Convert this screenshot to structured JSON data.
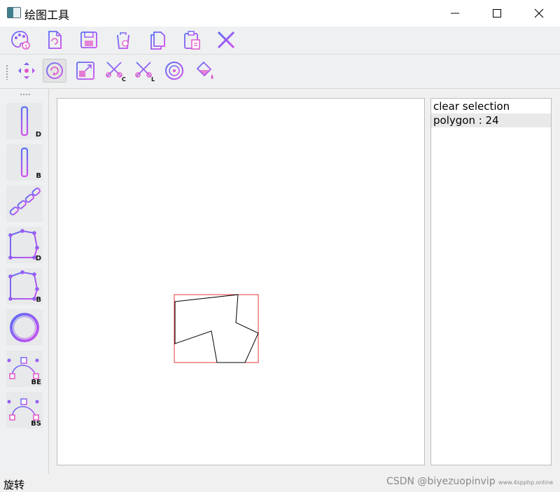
{
  "window": {
    "title": "绘图工具",
    "controls": [
      "minimize",
      "maximize",
      "close"
    ]
  },
  "toolbar_file": {
    "icons": [
      "palette-icon",
      "new-file-icon",
      "save-icon",
      "trash-icon",
      "copy-icon",
      "paste-icon",
      "close-x-icon"
    ]
  },
  "toolbar_transform": {
    "icons": [
      "move-icon",
      "rotate-icon",
      "scale-icon",
      "cut-cohen-icon",
      "cut-liang-icon",
      "center-icon",
      "fill-icon"
    ],
    "active": "rotate-icon",
    "cut_tags": [
      "C",
      "L"
    ]
  },
  "draw_tools": [
    {
      "name": "line-dda-tool",
      "tag": "D"
    },
    {
      "name": "line-bresenham-tool",
      "tag": "B"
    },
    {
      "name": "line-chain-tool",
      "tag": ""
    },
    {
      "name": "polygon-dda-tool",
      "tag": "D"
    },
    {
      "name": "polygon-bresenham-tool",
      "tag": "B"
    },
    {
      "name": "ellipse-tool",
      "tag": ""
    },
    {
      "name": "curve-bezier-tool",
      "tag": "BE"
    },
    {
      "name": "curve-bspline-tool",
      "tag": "BS"
    }
  ],
  "shape_list": {
    "items": [
      "clear selection",
      "polygon : 24"
    ],
    "selected_index": 1
  },
  "canvas": {
    "selection_color": "#e53935",
    "stroke_color": "#000000"
  },
  "status": {
    "text": "旋转",
    "watermark": "CSDN @biyezuopinvip",
    "watermark_small": "www.4spphp.online"
  },
  "colors": {
    "icon_gradient_start": "#5b6ef5",
    "icon_gradient_end": "#d04ef0",
    "icon_pink": "#e056c8"
  }
}
